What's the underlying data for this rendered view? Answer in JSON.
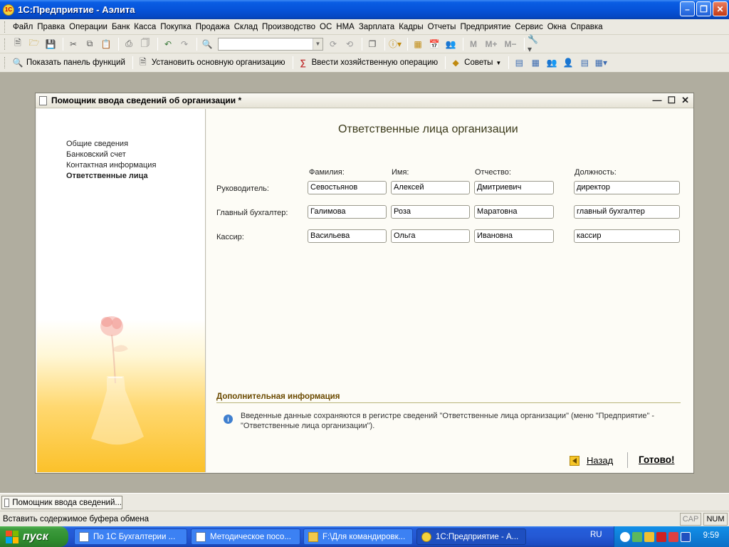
{
  "app": {
    "title": "1С:Предприятие - Аэлита",
    "icon_label": "1С"
  },
  "menu": [
    "Файл",
    "Правка",
    "Операции",
    "Банк",
    "Касса",
    "Покупка",
    "Продажа",
    "Склад",
    "Производство",
    "ОС",
    "НМА",
    "Зарплата",
    "Кадры",
    "Отчеты",
    "Предприятие",
    "Сервис",
    "Окна",
    "Справка"
  ],
  "toolbar2": {
    "show_panel": "Показать панель функций",
    "set_org": "Установить основную организацию",
    "enter_op": "Ввести хозяйственную операцию",
    "tips": "Советы"
  },
  "dialog": {
    "title": "Помощник ввода сведений об организации *",
    "steps": [
      {
        "label": "Общие сведения",
        "active": false
      },
      {
        "label": "Банковский счет",
        "active": false
      },
      {
        "label": "Контактная информация",
        "active": false
      },
      {
        "label": "Ответственные лица",
        "active": true
      }
    ],
    "page_title": "Ответственные лица организации",
    "columns": {
      "last_name": "Фамилия:",
      "first_name": "Имя:",
      "patronymic": "Отчество:",
      "position": "Должность:"
    },
    "rows": [
      {
        "label": "Руководитель:",
        "last_name": "Севостьянов",
        "first_name": "Алексей",
        "patronymic": "Дмитриевич",
        "position": "директор"
      },
      {
        "label": "Главный бухгалтер:",
        "last_name": "Галимова",
        "first_name": "Роза",
        "patronymic": "Маратовна",
        "position": "главный бухгалтер"
      },
      {
        "label": "Кассир:",
        "last_name": "Васильева",
        "first_name": "Ольга",
        "patronymic": "Ивановна",
        "position": "кассир"
      }
    ],
    "info_heading": "Дополнительная информация",
    "info_text": "Введенные данные сохраняются в регистре сведений \"Ответственные лица организации\" (меню \"Предприятие\" - \"Ответственные лица организации\").",
    "back_label": "Назад",
    "done_label": "Готово!"
  },
  "window_tab": "Помощник ввода сведений...",
  "status": {
    "text": "Вставить содержимое буфера обмена",
    "cap": "CAP",
    "num": "NUM"
  },
  "taskbar": {
    "start": "пуск",
    "tasks": [
      {
        "label": "По 1С Бухгалтерии ..."
      },
      {
        "label": "Методическое посо..."
      },
      {
        "label": "F:\\Для командировк..."
      },
      {
        "label": "1С:Предприятие - А..."
      }
    ],
    "lang": "RU",
    "clock": "9:59"
  },
  "colors": {
    "title_blue": "#0653d9",
    "accent_gold": "#fbc12a",
    "start_green": "#2f8f2f"
  }
}
